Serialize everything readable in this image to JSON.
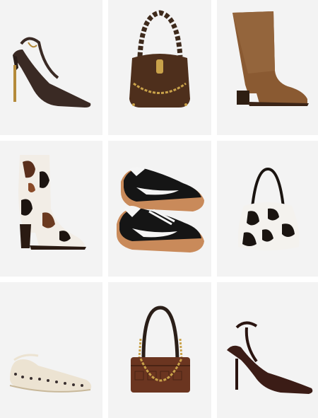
{
  "products": [
    {
      "icon": "slingback-pump-icon",
      "color": "#3a2a24"
    },
    {
      "icon": "chain-hobo-bag-icon",
      "color": "#4e2f1c"
    },
    {
      "icon": "suede-knee-boot-icon",
      "color": "#8a5a32"
    },
    {
      "icon": "cow-print-ankle-boot-icon",
      "color": "#f2ede6"
    },
    {
      "icon": "retro-sneakers-icon",
      "color": "#151515"
    },
    {
      "icon": "cow-print-shoulder-bag-icon",
      "color": "#f4f2ee"
    },
    {
      "icon": "studded-ballet-flat-icon",
      "color": "#ece3d2"
    },
    {
      "icon": "croc-chain-bag-icon",
      "color": "#6b3520"
    },
    {
      "icon": "ankle-strap-pump-icon",
      "color": "#3b1c16"
    }
  ]
}
